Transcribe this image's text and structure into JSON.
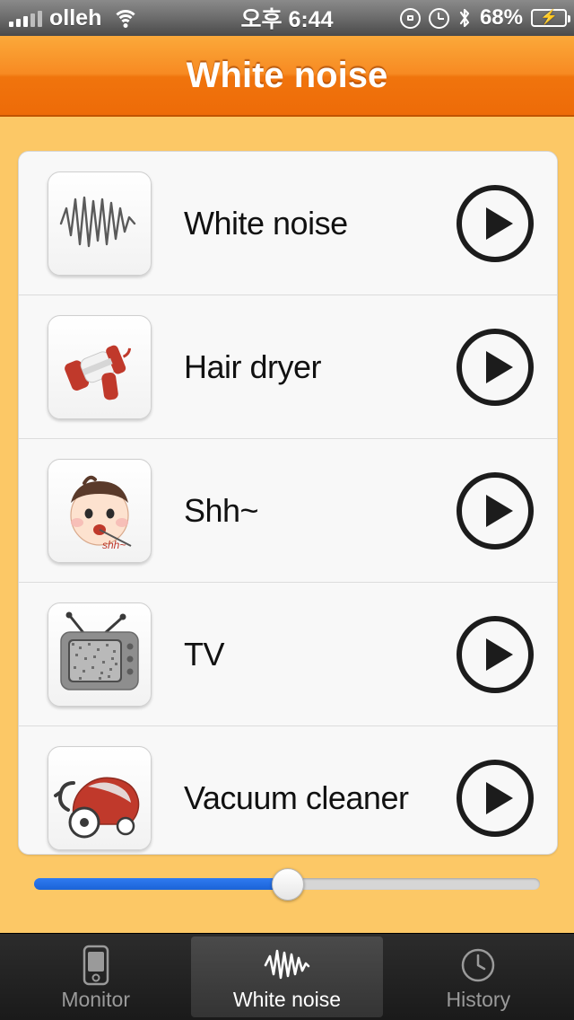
{
  "statusbar": {
    "carrier": "olleh",
    "signal_icon": "cellular-signal-icon",
    "wifi_icon": "wifi-icon",
    "time": "오후 6:44",
    "rotation_lock_icon": "rotation-lock-icon",
    "alarm_icon": "alarm-clock-icon",
    "bluetooth_icon": "bluetooth-icon",
    "battery_percent": "68%",
    "battery_icon": "battery-charging-icon",
    "battery_level": 68
  },
  "navbar": {
    "title": "White noise"
  },
  "list": {
    "items": [
      {
        "label": "White noise",
        "thumb_icon": "waveform-thumbnail-icon",
        "play_icon": "play-icon"
      },
      {
        "label": "Hair dryer",
        "thumb_icon": "hair-dryer-thumbnail-icon",
        "play_icon": "play-icon"
      },
      {
        "label": "Shh~",
        "thumb_icon": "shushing-face-thumbnail-icon",
        "play_icon": "play-icon"
      },
      {
        "label": "TV",
        "thumb_icon": "television-thumbnail-icon",
        "play_icon": "play-icon"
      },
      {
        "label": "Vacuum cleaner",
        "thumb_icon": "vacuum-cleaner-thumbnail-icon",
        "play_icon": "play-icon"
      }
    ]
  },
  "volume": {
    "value": 50,
    "fill_color": "#1b63d8",
    "track_color": "#d6d6d6"
  },
  "tabbar": {
    "items": [
      {
        "label": "Monitor",
        "icon": "phone-monitor-icon",
        "active": false
      },
      {
        "label": "White noise",
        "icon": "waveform-icon",
        "active": true
      },
      {
        "label": "History",
        "icon": "clock-history-icon",
        "active": false
      }
    ]
  },
  "colors": {
    "background": "#fcc866",
    "navbar_top": "#fba93a",
    "navbar_bottom": "#ee6b08",
    "list_background": "#f8f8f8"
  }
}
